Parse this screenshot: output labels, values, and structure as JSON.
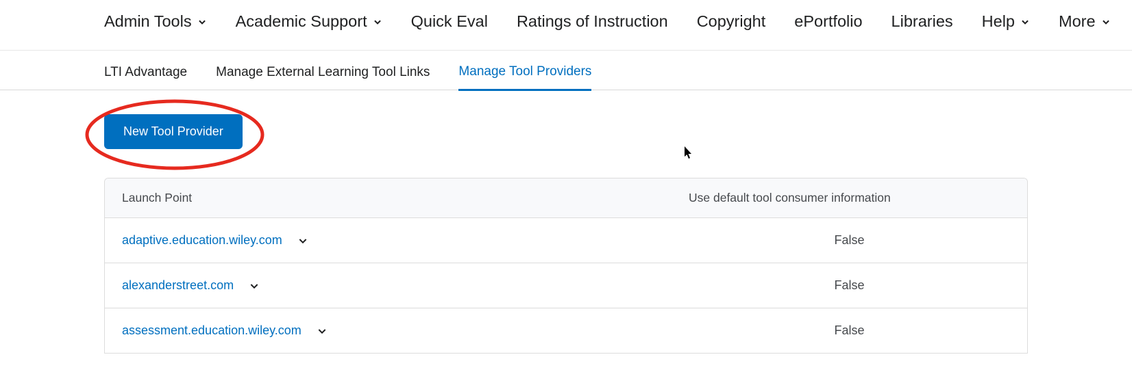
{
  "topnav": {
    "items": [
      {
        "label": "Admin Tools",
        "dropdown": true
      },
      {
        "label": "Academic Support",
        "dropdown": true
      },
      {
        "label": "Quick Eval",
        "dropdown": false
      },
      {
        "label": "Ratings of Instruction",
        "dropdown": false
      },
      {
        "label": "Copyright",
        "dropdown": false
      },
      {
        "label": "ePortfolio",
        "dropdown": false
      },
      {
        "label": "Libraries",
        "dropdown": false
      },
      {
        "label": "Help",
        "dropdown": true
      },
      {
        "label": "More",
        "dropdown": true
      }
    ]
  },
  "tabs": {
    "items": [
      {
        "label": "LTI Advantage",
        "active": false
      },
      {
        "label": "Manage External Learning Tool Links",
        "active": false
      },
      {
        "label": "Manage Tool Providers",
        "active": true
      }
    ]
  },
  "actions": {
    "new_tool_provider": "New Tool Provider"
  },
  "table": {
    "headers": {
      "launch_point": "Launch Point",
      "use_default": "Use default tool consumer information"
    },
    "rows": [
      {
        "launch_point": "adaptive.education.wiley.com",
        "use_default": "False"
      },
      {
        "launch_point": "alexanderstreet.com",
        "use_default": "False"
      },
      {
        "launch_point": "assessment.education.wiley.com",
        "use_default": "False"
      }
    ]
  },
  "annotation": {
    "highlight_color": "#e62a1f"
  }
}
